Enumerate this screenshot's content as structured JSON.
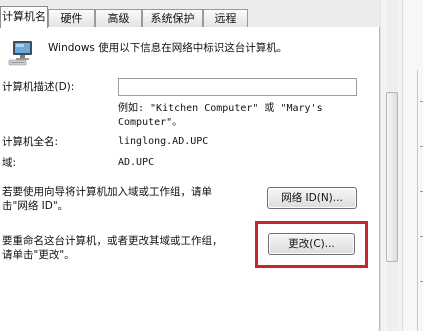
{
  "tabs": [
    {
      "label": "计算机名",
      "active": true
    },
    {
      "label": "硬件",
      "active": false
    },
    {
      "label": "高级",
      "active": false
    },
    {
      "label": "系统保护",
      "active": false
    },
    {
      "label": "远程",
      "active": false
    }
  ],
  "intro_text": "Windows 使用以下信息在网络中标识这台计算机。",
  "description": {
    "label": "计算机描述(D):",
    "value": "",
    "example_line1": "例如: \"Kitchen Computer\" 或 \"Mary's",
    "example_line2": "Computer\"。"
  },
  "full_name": {
    "label": "计算机全名:",
    "value": "linglong.AD.UPC"
  },
  "domain": {
    "label": "域:",
    "value": "AD.UPC"
  },
  "network_id": {
    "text_line1": "若要使用向导将计算机加入域或工作组，请单",
    "text_line2": "击\"网络 ID\"。",
    "button_label": "网络 ID(N)..."
  },
  "change": {
    "text_line1": "要重命名这台计算机，或者更改其域或工作组，",
    "text_line2": "请单击\"更改\"。",
    "button_label": "更改(C)...",
    "highlight_color": "#c8252b"
  },
  "icons": {
    "computer": "computer-icon"
  }
}
